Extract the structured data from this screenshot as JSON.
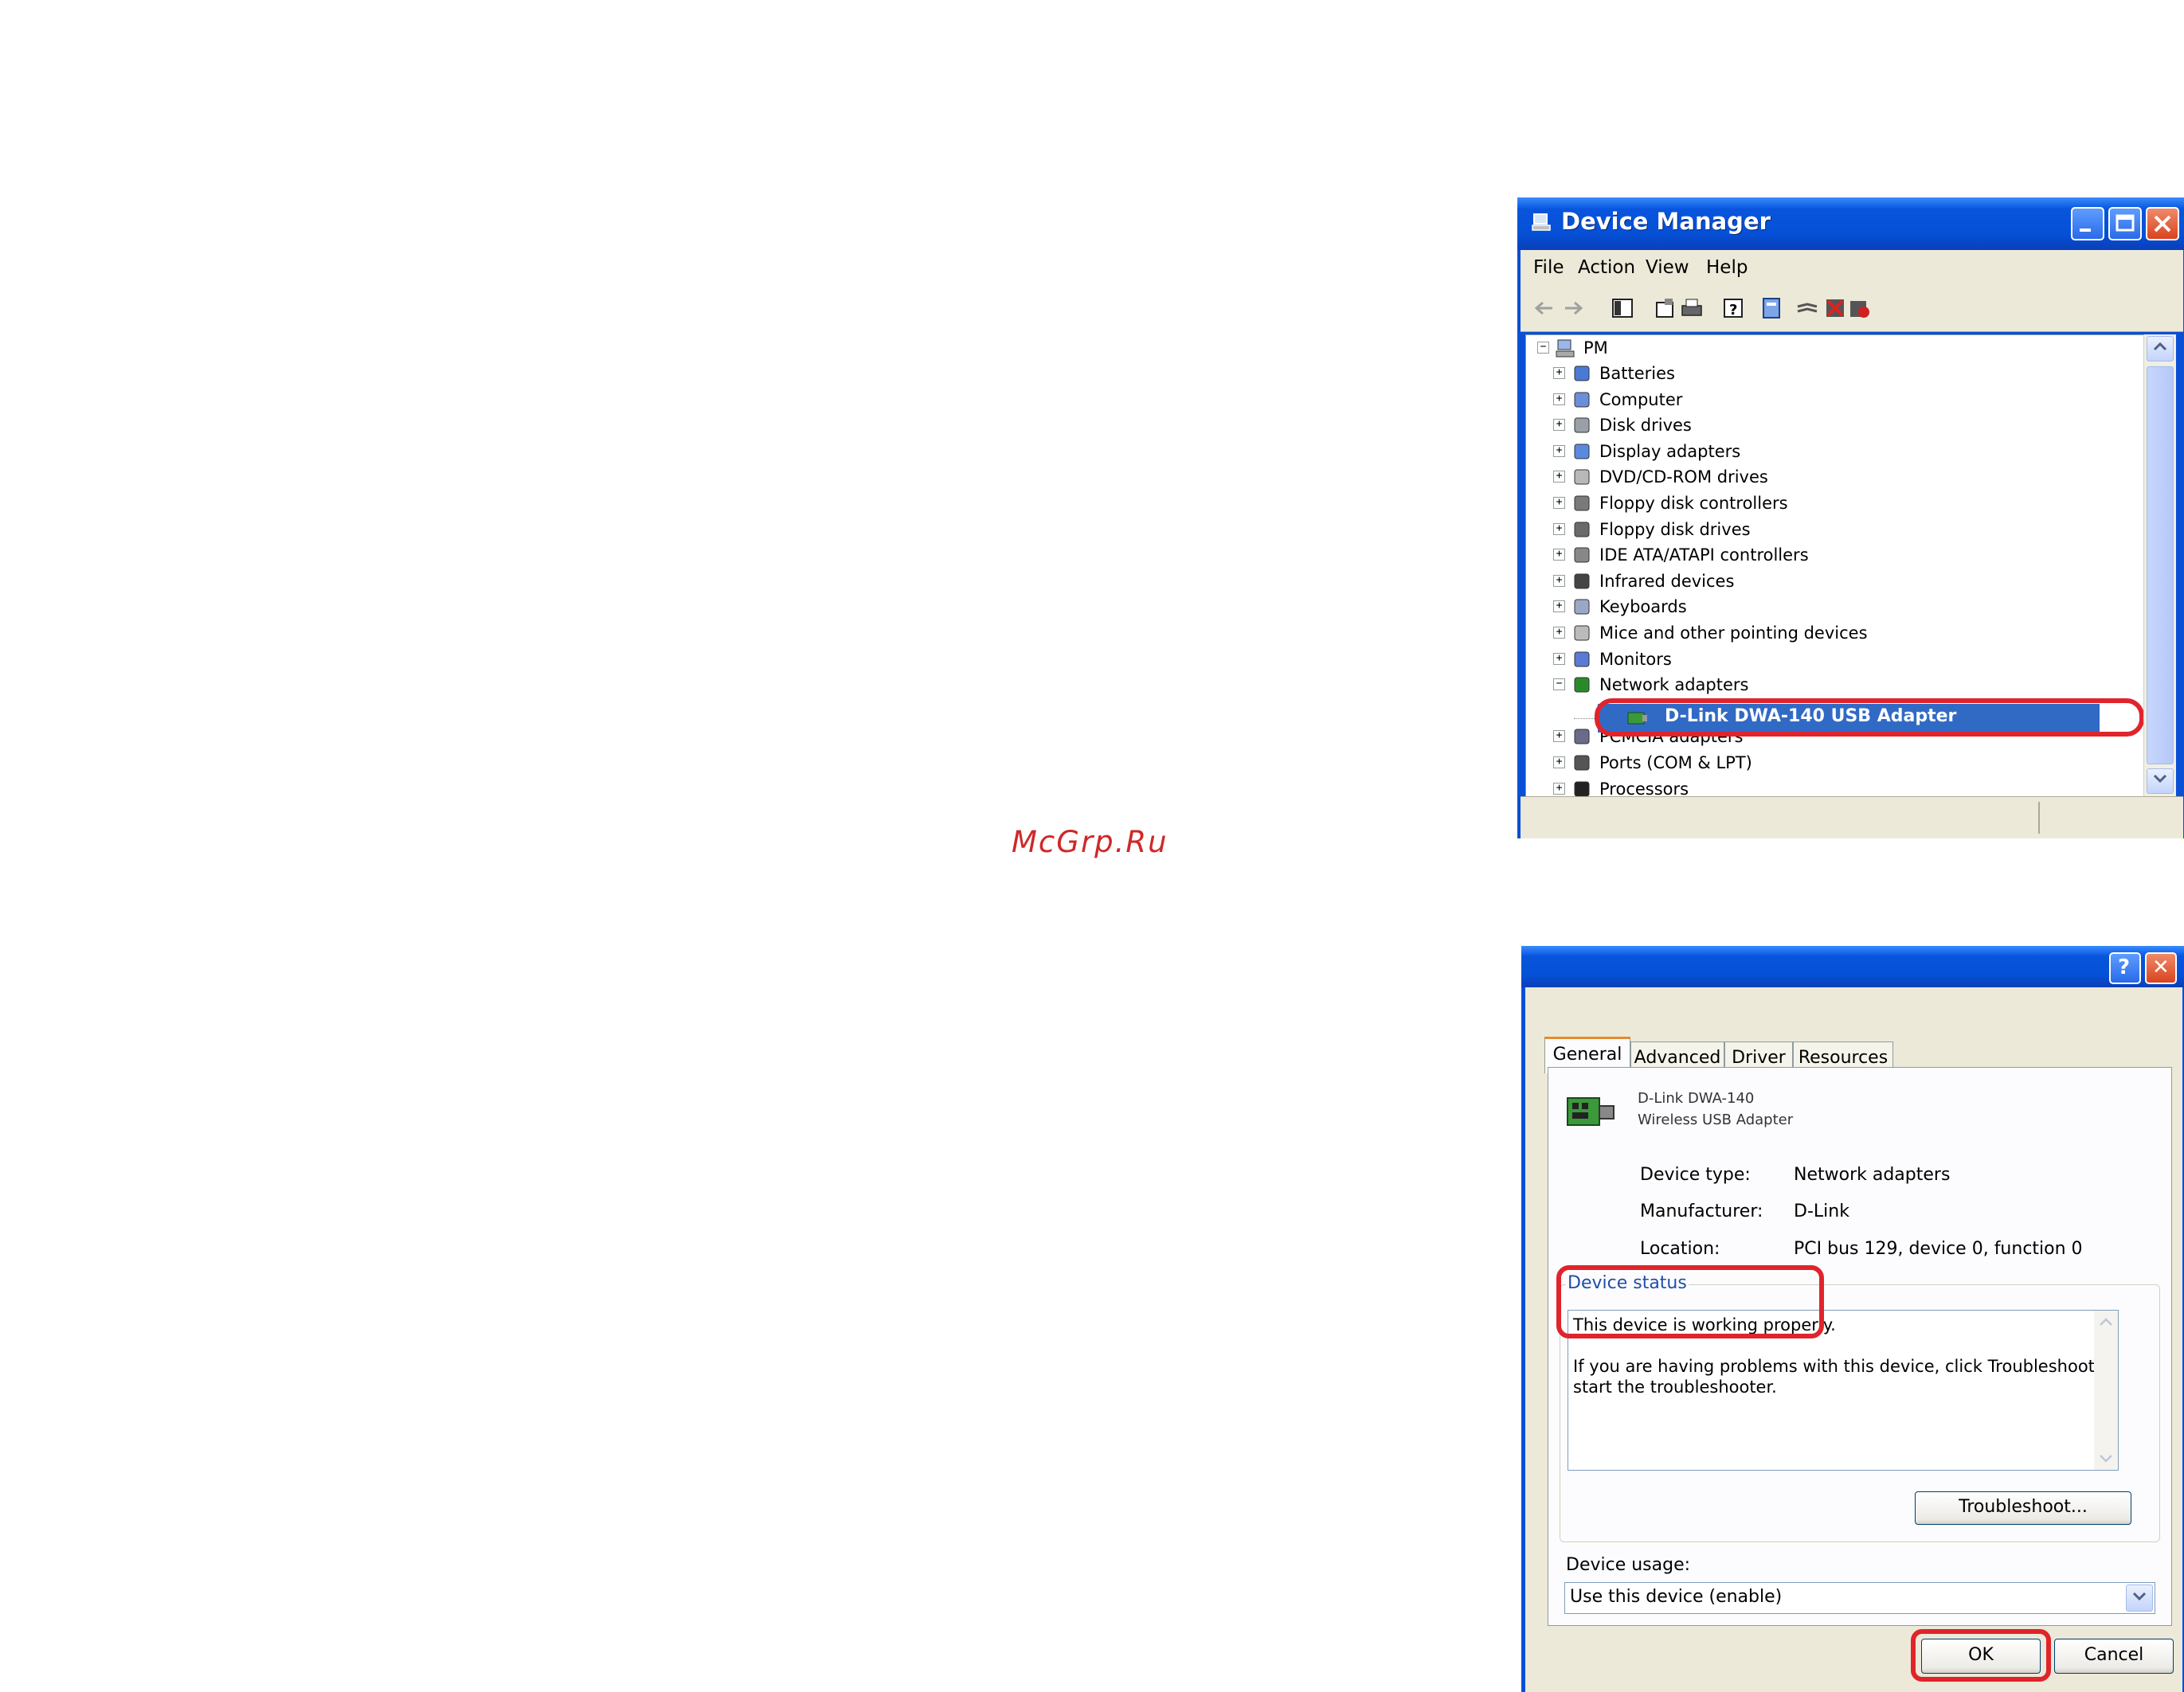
{
  "watermark": "McGrp.Ru",
  "device_manager": {
    "title": "Device Manager",
    "menu": [
      "File",
      "Action",
      "View",
      "Help"
    ],
    "toolbar_icons": [
      "back-icon",
      "forward-icon",
      "show-hide-tree-icon",
      "properties-icon",
      "print-icon",
      "help-icon",
      "update-driver-icon",
      "uninstall-icon",
      "disable-icon",
      "scan-changes-icon"
    ],
    "tree": {
      "root": "PM",
      "items": [
        {
          "label": "Batteries",
          "icon": "battery-icon"
        },
        {
          "label": "Computer",
          "icon": "computer-icon"
        },
        {
          "label": "Disk drives",
          "icon": "disk-drive-icon"
        },
        {
          "label": "Display adapters",
          "icon": "display-adapter-icon"
        },
        {
          "label": "DVD/CD-ROM drives",
          "icon": "cdrom-icon"
        },
        {
          "label": "Floppy disk controllers",
          "icon": "floppy-controller-icon"
        },
        {
          "label": "Floppy disk drives",
          "icon": "floppy-drive-icon"
        },
        {
          "label": "IDE ATA/ATAPI controllers",
          "icon": "ide-controller-icon"
        },
        {
          "label": "Infrared devices",
          "icon": "infrared-icon"
        },
        {
          "label": "Keyboards",
          "icon": "keyboard-icon"
        },
        {
          "label": "Mice and other pointing devices",
          "icon": "mouse-icon"
        },
        {
          "label": "Monitors",
          "icon": "monitor-icon"
        },
        {
          "label": "Network adapters",
          "icon": "network-adapter-icon"
        },
        {
          "label": "D-Link DWA-140 USB Adapter",
          "icon": "network-card-icon"
        },
        {
          "label": "PCMCIA adapters",
          "icon": "pcmcia-icon"
        },
        {
          "label": "Ports (COM & LPT)",
          "icon": "port-icon"
        },
        {
          "label": "Processors",
          "icon": "processor-icon"
        }
      ]
    }
  },
  "properties": {
    "tabs": [
      "General",
      "Advanced",
      "Driver",
      "Resources"
    ],
    "device_name_line1": "D-Link DWA-140",
    "device_name_line2": "Wireless USB Adapter",
    "device_type_label": "Device type:",
    "device_type_value": "Network adapters",
    "manufacturer_label": "Manufacturer:",
    "manufacturer_value": "D-Link",
    "location_label": "Location:",
    "location_value": "PCI bus 129, device 0, function 0",
    "status_group": "Device status",
    "status_line1": "This device is working properly.",
    "status_line2": "If you are having problems with this device, click Troubleshoot to",
    "status_line3": "start the troubleshooter.",
    "troubleshoot_label": "Troubleshoot...",
    "usage_label": "Device usage:",
    "usage_value": "Use this device (enable)",
    "ok_label": "OK",
    "cancel_label": "Cancel",
    "help_glyph": "?",
    "close_glyph": "✕"
  },
  "colors": {
    "title_blue": "#0550d6",
    "selection_blue": "#316ac5",
    "highlight_red": "#e0242c",
    "watermark_red": "#cf2828"
  }
}
